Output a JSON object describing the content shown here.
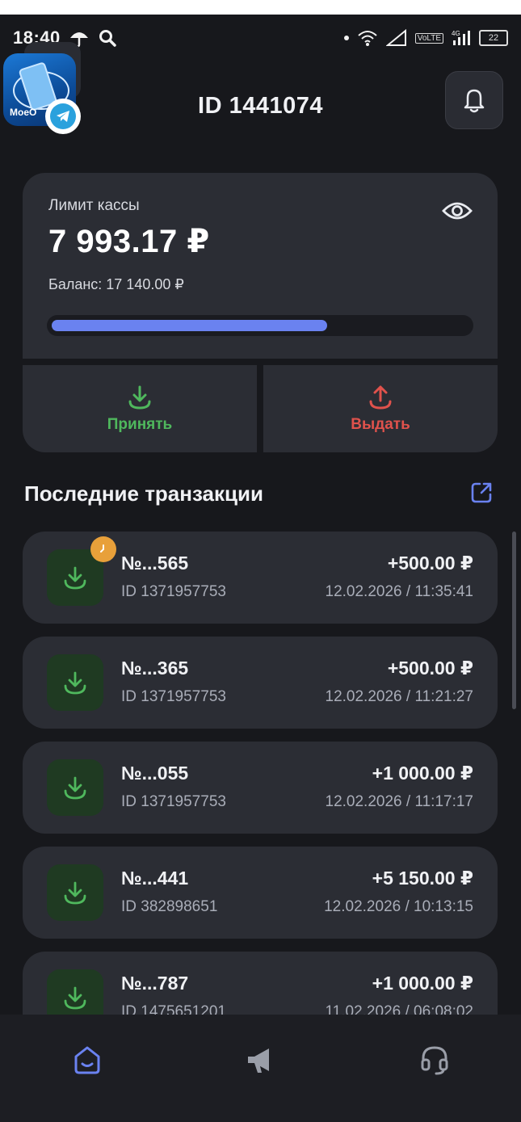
{
  "status_bar": {
    "time": "18:40",
    "network": "4G",
    "volte": "VoLTE",
    "battery": "22"
  },
  "header": {
    "title": "ID 1441074",
    "app_badge_text": "МоеО"
  },
  "limit_card": {
    "label": "Лимит кассы",
    "amount": "7 993.17 ₽",
    "balance": "Баланс: 17 140.00 ₽",
    "progress_fraction": 0.66
  },
  "actions": {
    "accept_label": "Принять",
    "issue_label": "Выдать"
  },
  "section": {
    "title": "Последние транзакции"
  },
  "transactions": [
    {
      "number": "№...565",
      "id": "ID 1371957753",
      "amount": "+500.00 ₽",
      "date": "12.02.2026 / 11:35:41",
      "pending": true
    },
    {
      "number": "№...365",
      "id": "ID 1371957753",
      "amount": "+500.00 ₽",
      "date": "12.02.2026 / 11:21:27",
      "pending": false
    },
    {
      "number": "№...055",
      "id": "ID 1371957753",
      "amount": "+1 000.00 ₽",
      "date": "12.02.2026 / 11:17:17",
      "pending": false
    },
    {
      "number": "№...441",
      "id": "ID 382898651",
      "amount": "+5 150.00 ₽",
      "date": "12.02.2026 / 10:13:15",
      "pending": false
    },
    {
      "number": "№...787",
      "id": "ID 1475651201",
      "amount": "+1 000.00 ₽",
      "date": "11.02.2026 / 06:08:02",
      "pending": false
    }
  ],
  "colors": {
    "accent": "#6a82f0",
    "accept": "#4fb85d",
    "issue": "#e0524c",
    "pending": "#e8a03a"
  },
  "bottom_nav": [
    {
      "icon": "home-icon",
      "active": true
    },
    {
      "icon": "megaphone-icon",
      "active": false
    },
    {
      "icon": "headset-icon",
      "active": false
    }
  ]
}
